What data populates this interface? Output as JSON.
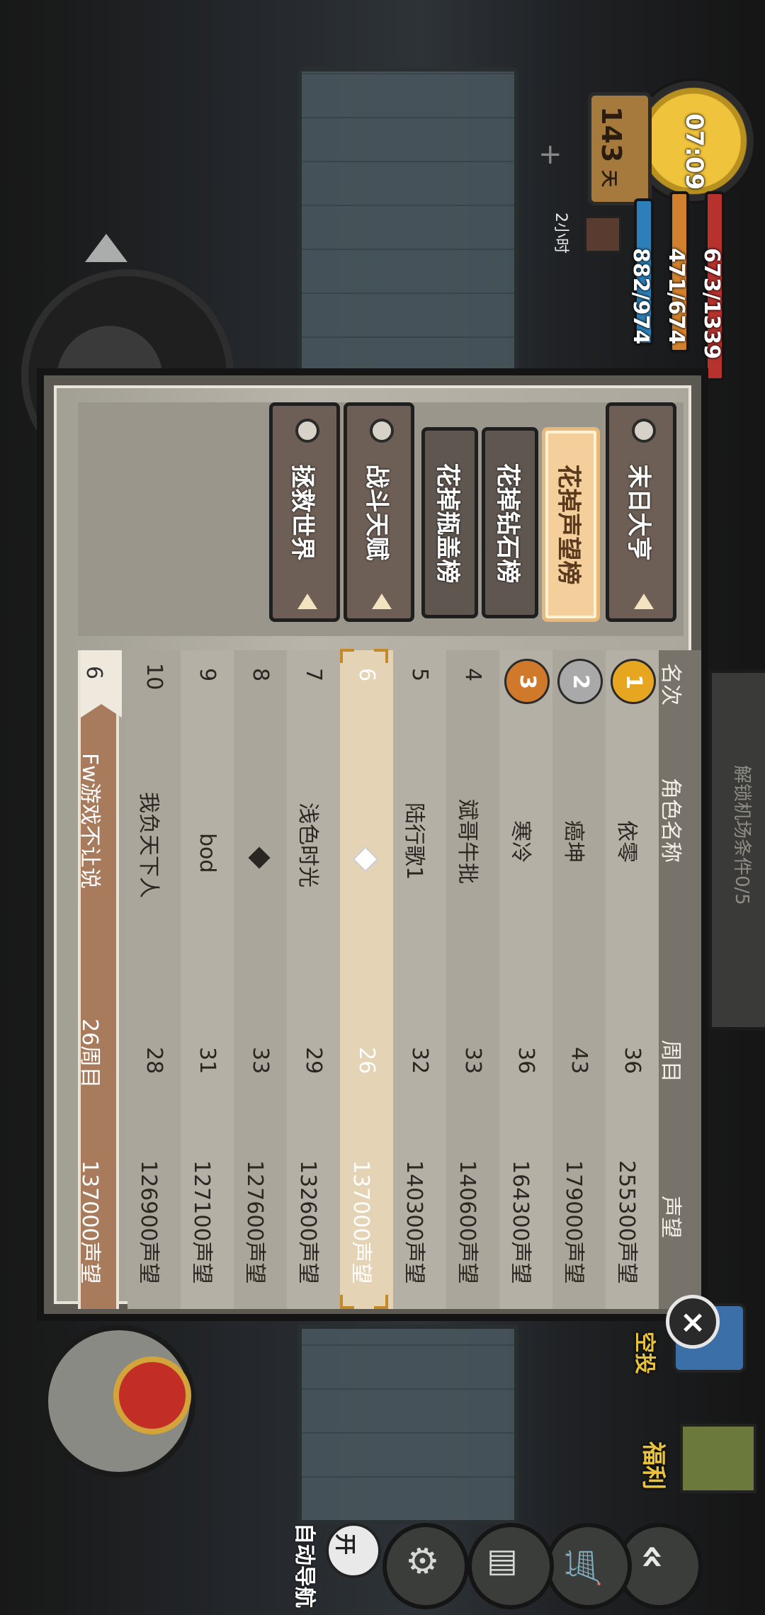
{
  "hud": {
    "clock": "07:09",
    "day_number": "143",
    "day_unit": "天",
    "hp": "673/1339",
    "hunger": "471/674",
    "water": "882/974",
    "buff_time": "2小时"
  },
  "unlock_panel": {
    "text": "解锁机场条件0/5"
  },
  "side_buttons": {
    "welfare": "福利",
    "supply": "空投",
    "auto_nav_label": "自动导航",
    "auto_nav_toggle": "开"
  },
  "tabs": [
    {
      "label": "末日大亨",
      "style": "gear"
    },
    {
      "label": "花掉声望榜",
      "style": "active"
    },
    {
      "label": "花掉钻石榜",
      "style": "small"
    },
    {
      "label": "花掉瓶盖榜",
      "style": "small"
    },
    {
      "label": "战斗天赋",
      "style": "gear"
    },
    {
      "label": "拯救世界",
      "style": "gear"
    }
  ],
  "table": {
    "headers": {
      "rank": "名次",
      "name": "角色名称",
      "week": "周目",
      "fame": "声望"
    },
    "rows": [
      {
        "rank": "1",
        "name": "依零",
        "week": "36",
        "fame": "255300声望"
      },
      {
        "rank": "2",
        "name": "癌坤",
        "week": "43",
        "fame": "179000声望"
      },
      {
        "rank": "3",
        "name": "寒冷",
        "week": "36",
        "fame": "164300声望"
      },
      {
        "rank": "4",
        "name": "斌哥牛批",
        "week": "33",
        "fame": "140600声望"
      },
      {
        "rank": "5",
        "name": "陆行歌1",
        "week": "32",
        "fame": "140300声望"
      },
      {
        "rank": "6",
        "name": "",
        "week": "26",
        "fame": "137000声望"
      },
      {
        "rank": "7",
        "name": "浅色时光",
        "week": "29",
        "fame": "132600声望"
      },
      {
        "rank": "8",
        "name": "",
        "week": "33",
        "fame": "127600声望"
      },
      {
        "rank": "9",
        "name": "bod",
        "week": "31",
        "fame": "127100声望"
      },
      {
        "rank": "10",
        "name": "我负天下人",
        "week": "28",
        "fame": "126900声望"
      }
    ],
    "highlight_rank": "6",
    "my": {
      "rank": "6",
      "name": "Fw游戏不让说",
      "week": "26周目",
      "fame": "137000声望"
    }
  }
}
